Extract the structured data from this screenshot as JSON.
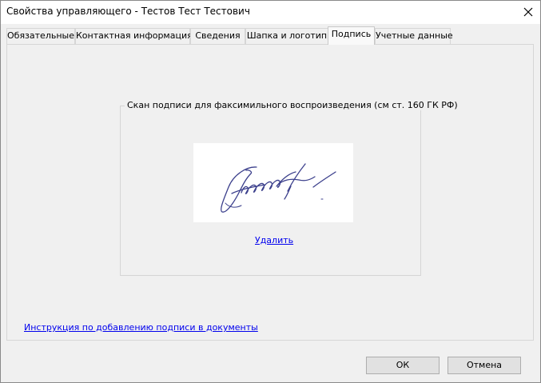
{
  "window": {
    "title": "Свойства управляющего - Тестов Тест Тестович"
  },
  "tabs": [
    {
      "label": "Обязательные",
      "active": false
    },
    {
      "label": "Контактная информация",
      "active": false
    },
    {
      "label": "Сведения",
      "active": false
    },
    {
      "label": "Шапка и логотип",
      "active": false
    },
    {
      "label": "Подпись",
      "active": true
    },
    {
      "label": "Учетные данные",
      "active": false
    }
  ],
  "signature_group": {
    "legend": "Скан подписи для факсимильного воспроизведения (см ст. 160 ГК РФ)",
    "delete_link": "Удалить",
    "signature_ink_color": "#3b3f8c"
  },
  "instructions_link": "Инструкция по добавлению подписи в документы",
  "buttons": {
    "ok": "ОК",
    "cancel": "Отмена"
  }
}
